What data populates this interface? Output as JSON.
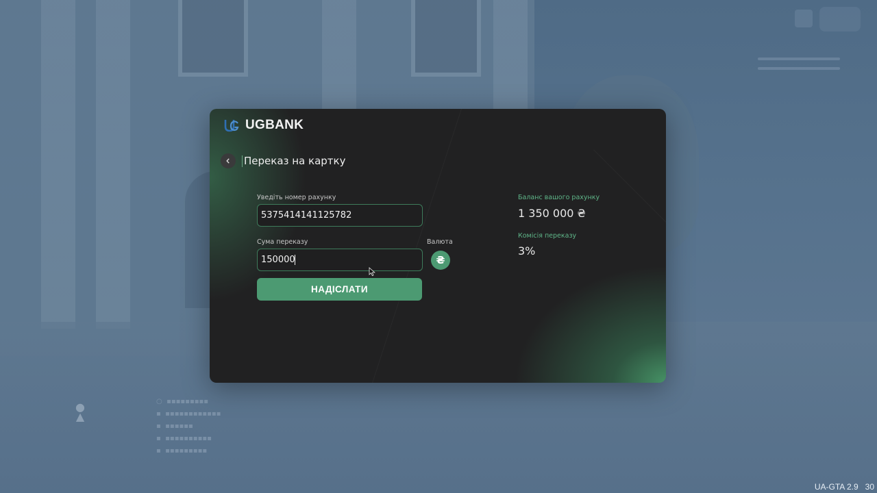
{
  "app": {
    "brand_name": "UGBANK"
  },
  "header": {
    "title": "Переказ на картку",
    "back_icon": "chevron-left-icon"
  },
  "form": {
    "account_label": "Уведіть номер рахунку",
    "account_value": "5375414141125782",
    "amount_label": "Сума переказу",
    "amount_value": "150000",
    "currency_label": "Валюта",
    "currency_symbol": "₴",
    "submit_label": "НАДІСЛАТИ"
  },
  "info": {
    "balance_label": "Баланс вашого рахунку",
    "balance_value": "1 350 000 ₴",
    "fee_label": "Комісія переказу",
    "fee_value": "3%"
  },
  "hud": {
    "version": "UA-GTA 2.9",
    "version_suffix": "30"
  },
  "colors": {
    "accent": "#4c9a72",
    "accent_text": "#5fb689",
    "panel_bg": "#212122"
  }
}
